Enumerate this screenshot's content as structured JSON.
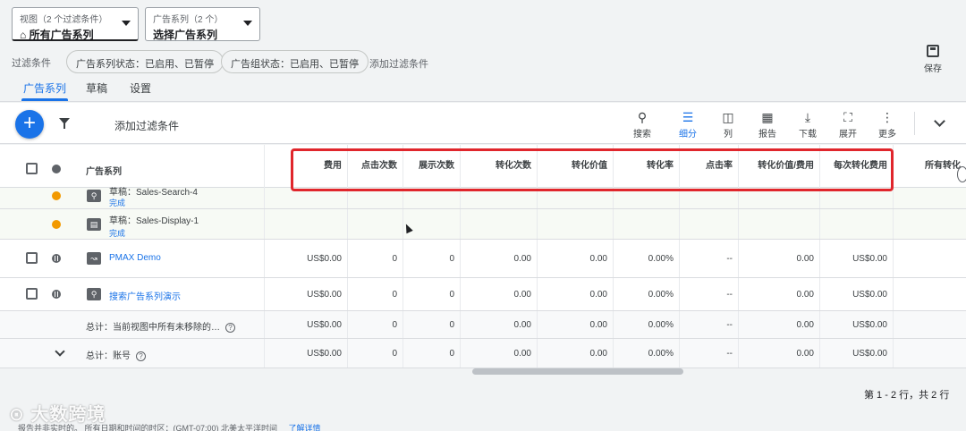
{
  "view_selector": {
    "label": "视图（2 个过滤条件）",
    "value": "所有广告系列"
  },
  "campaign_selector": {
    "label": "广告系列（2 个）",
    "value": "选择广告系列"
  },
  "filters": {
    "label": "过滤条件",
    "chips": [
      "广告系列状态：已启用、已暂停",
      "广告组状态：已启用、已暂停"
    ],
    "add": "添加过滤条件"
  },
  "save": {
    "label": "保存"
  },
  "tabs": [
    {
      "label": "广告系列",
      "active": true
    },
    {
      "label": "草稿",
      "active": false
    },
    {
      "label": "设置",
      "active": false
    }
  ],
  "toolbar": {
    "add_filter": "添加过滤条件",
    "tools": [
      {
        "label": "搜索",
        "icon": "search-icon"
      },
      {
        "label": "细分",
        "icon": "segment-icon",
        "active": true
      },
      {
        "label": "列",
        "icon": "columns-icon"
      },
      {
        "label": "报告",
        "icon": "reports-icon"
      },
      {
        "label": "下载",
        "icon": "download-icon"
      },
      {
        "label": "展开",
        "icon": "expand-icon"
      },
      {
        "label": "更多",
        "icon": "more-icon"
      }
    ]
  },
  "table": {
    "headers": {
      "campaign": "广告系列",
      "metrics": [
        "费用",
        "点击次数",
        "展示次数",
        "转化次数",
        "转化价值",
        "转化率",
        "点击率",
        "转化价值/费用",
        "每次转化费用",
        "所有转化"
      ]
    },
    "drafts": [
      {
        "name": "草稿：Sales-Search-4",
        "status": "完成"
      },
      {
        "name": "草稿：Sales-Display-1",
        "status": "完成"
      }
    ],
    "rows": [
      {
        "name": "PMAX Demo",
        "values": [
          "US$0.00",
          "0",
          "0",
          "0.00",
          "0.00",
          "0.00%",
          "--",
          "0.00",
          "US$0.00"
        ]
      },
      {
        "name": "搜索广告系列演示",
        "values": [
          "US$0.00",
          "0",
          "0",
          "0.00",
          "0.00",
          "0.00%",
          "--",
          "0.00",
          "US$0.00"
        ]
      }
    ],
    "totals": [
      {
        "label": "总计：当前视图中所有未移除的…",
        "values": [
          "US$0.00",
          "0",
          "0",
          "0.00",
          "0.00",
          "0.00%",
          "--",
          "0.00",
          "US$0.00"
        ]
      },
      {
        "label": "总计：账号",
        "values": [
          "US$0.00",
          "0",
          "0",
          "0.00",
          "0.00",
          "0.00%",
          "--",
          "0.00",
          "US$0.00"
        ]
      }
    ]
  },
  "pager": {
    "text": "第 1 - 2 行，共 2 行"
  },
  "watermark": "大数跨境",
  "footer": {
    "text": "报告并非实时的。 所有日期和时间的时区：(GMT-07:00) 北美太平洋时间",
    "link": "了解详情"
  },
  "colors": {
    "accent": "#1a73e8",
    "highlight_box": "#e0262c",
    "draft_status": "#f29900"
  }
}
